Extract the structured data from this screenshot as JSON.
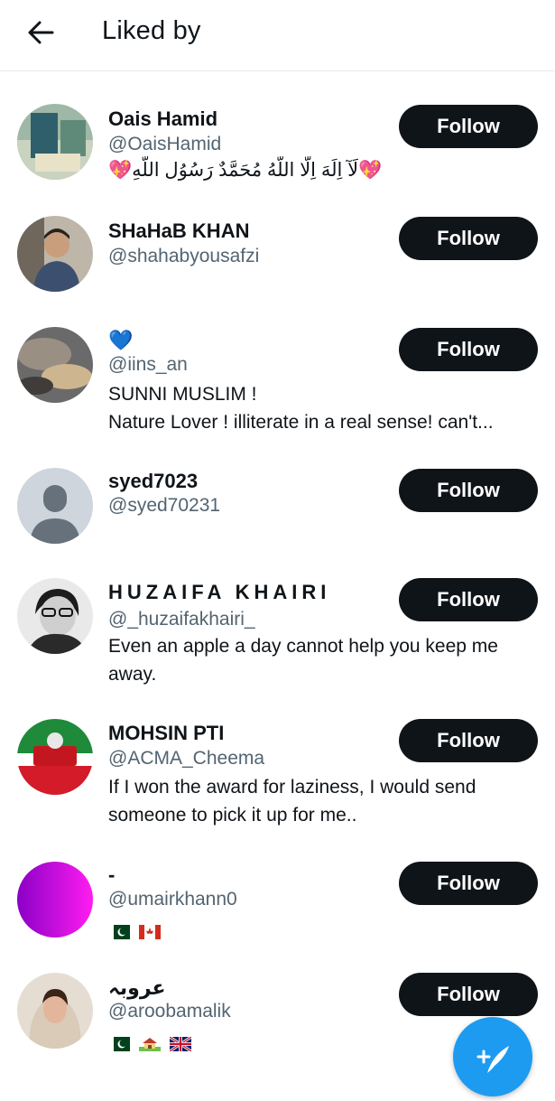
{
  "header": {
    "title": "Liked by",
    "back_icon": "arrow-left-icon"
  },
  "follow_label": "Follow",
  "users": [
    {
      "name": "Oais Hamid",
      "handle": "@OaisHamid",
      "bio": [
        "💖لَآ اِلَهَ اِلّا اللّهُ مُحَمَّدٌ رَسُوُل اللّهِ💖"
      ]
    },
    {
      "name": "SHaHaB KHAN",
      "handle": "@shahabyousafzi",
      "bio": []
    },
    {
      "name": "💙",
      "handle": "@iins_an",
      "bio": [
        "SUNNI MUSLIM !",
        "Nature Lover ! illiterate in a real sense! can't..."
      ]
    },
    {
      "name": "syed7023",
      "handle": "@syed70231",
      "bio": []
    },
    {
      "name": "HUZAIFA KHAIRI",
      "handle": "@_huzaifakhairi_",
      "bio": [
        "Even an apple a day cannot help you keep me",
        "away."
      ]
    },
    {
      "name": "MOHSIN PTI",
      "handle": "@ACMA_Cheema",
      "bio": [
        "If I won the award for laziness, I would send",
        "someone to pick it up for me.."
      ]
    },
    {
      "name": "-",
      "handle": "@umairkhann0",
      "bio": [],
      "flags": [
        "pakistan-flag",
        "canada-flag"
      ]
    },
    {
      "name": "عروبہ",
      "handle": "@aroobamalik",
      "bio": [],
      "flags": [
        "pakistan-flag",
        "house-with-garden-emoji",
        "uk-flag"
      ]
    }
  ],
  "colors": {
    "accent": "#1d9bf0",
    "button": "#0f1419",
    "secondary_text": "#536471"
  },
  "fab_icon": "compose-tweet-icon"
}
